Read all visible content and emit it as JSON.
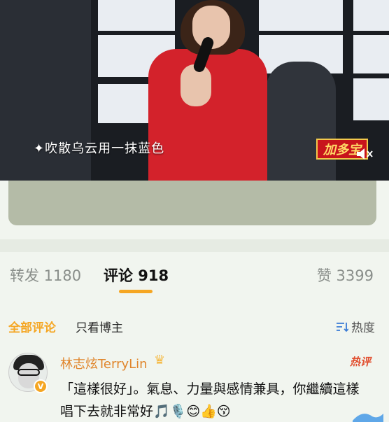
{
  "video": {
    "lyric": "✦吹散乌云用一抹蓝色",
    "badge": "加多宝",
    "mute_icon": "speaker-mute-icon"
  },
  "tabs": {
    "repost": "转发 1180",
    "comment": "评论 918",
    "like": "赞 3399"
  },
  "filters": {
    "all": "全部评论",
    "op_only": "只看博主",
    "sort": "热度",
    "sort_icon": "sort-icon"
  },
  "comment": {
    "username": "林志炫TerryLin",
    "crown_icon": "crown-icon",
    "hot_tag": "热评",
    "text": "「這樣很好」。氣息、力量與感情兼具，你繼續這樣唱下去就非常好🎵🎙️😊👍😚",
    "accent_color": "#e0852b"
  }
}
